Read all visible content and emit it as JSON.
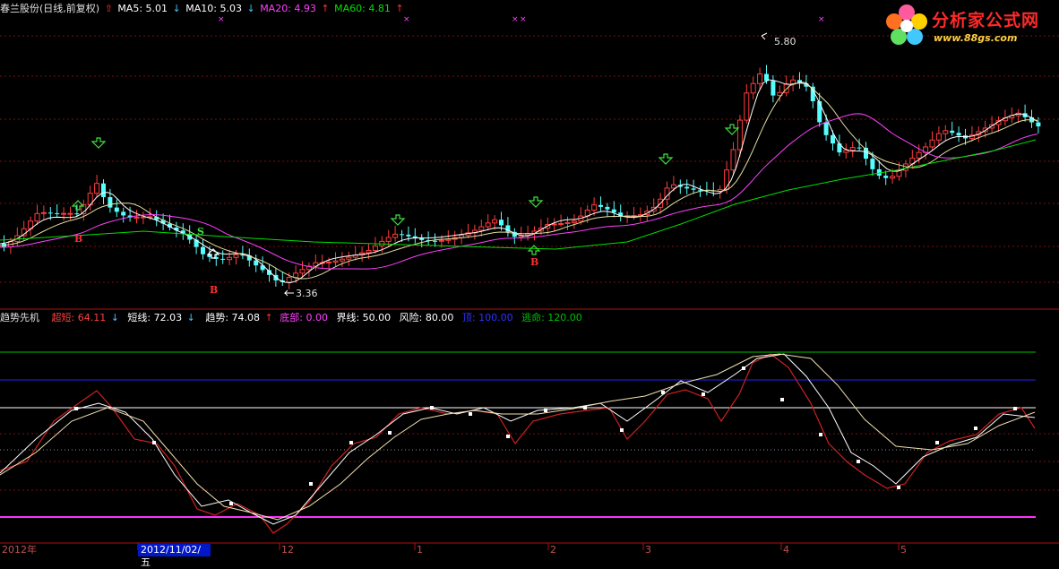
{
  "header": {
    "title": "春兰股份(日线,前复权)",
    "ma5": "MA5: 5.01",
    "ma10": "MA10: 5.03",
    "ma20": "MA20: 4.93",
    "ma60": "MA60: 4.81"
  },
  "indicator": {
    "name": "趋势先机",
    "chaoduan": "超短: 64.11",
    "duanxian": "短线: 72.03",
    "qushi": "趋势: 74.08",
    "dibu": "底部: 0.00",
    "jiexian": "界线: 50.00",
    "fengxian": "风险: 80.00",
    "ding": "顶: 100.00",
    "taoming": "逃命: 120.00"
  },
  "annotations": {
    "high": "5.80",
    "low": "3.36",
    "buy": "B",
    "sell": "S"
  },
  "logo": {
    "title": "分析家公式网",
    "url": "www.88gs.com"
  },
  "xaxis": {
    "year": "2012年",
    "date_box": "2012/11/02/五",
    "m12": "12",
    "m1": "1",
    "m2": "2",
    "m3": "3",
    "m4": "4",
    "m5": "5"
  },
  "colors": {
    "bg": "#000000",
    "up": "#ff3c3c",
    "down": "#54ffff",
    "ma5": "#ffffff",
    "ma10": "#ffff00",
    "ma20": "#ff40ff",
    "ma60": "#00e000",
    "ding": "#2020ff",
    "taoming": "#00c000",
    "dibu": "#ff30ff"
  }
}
